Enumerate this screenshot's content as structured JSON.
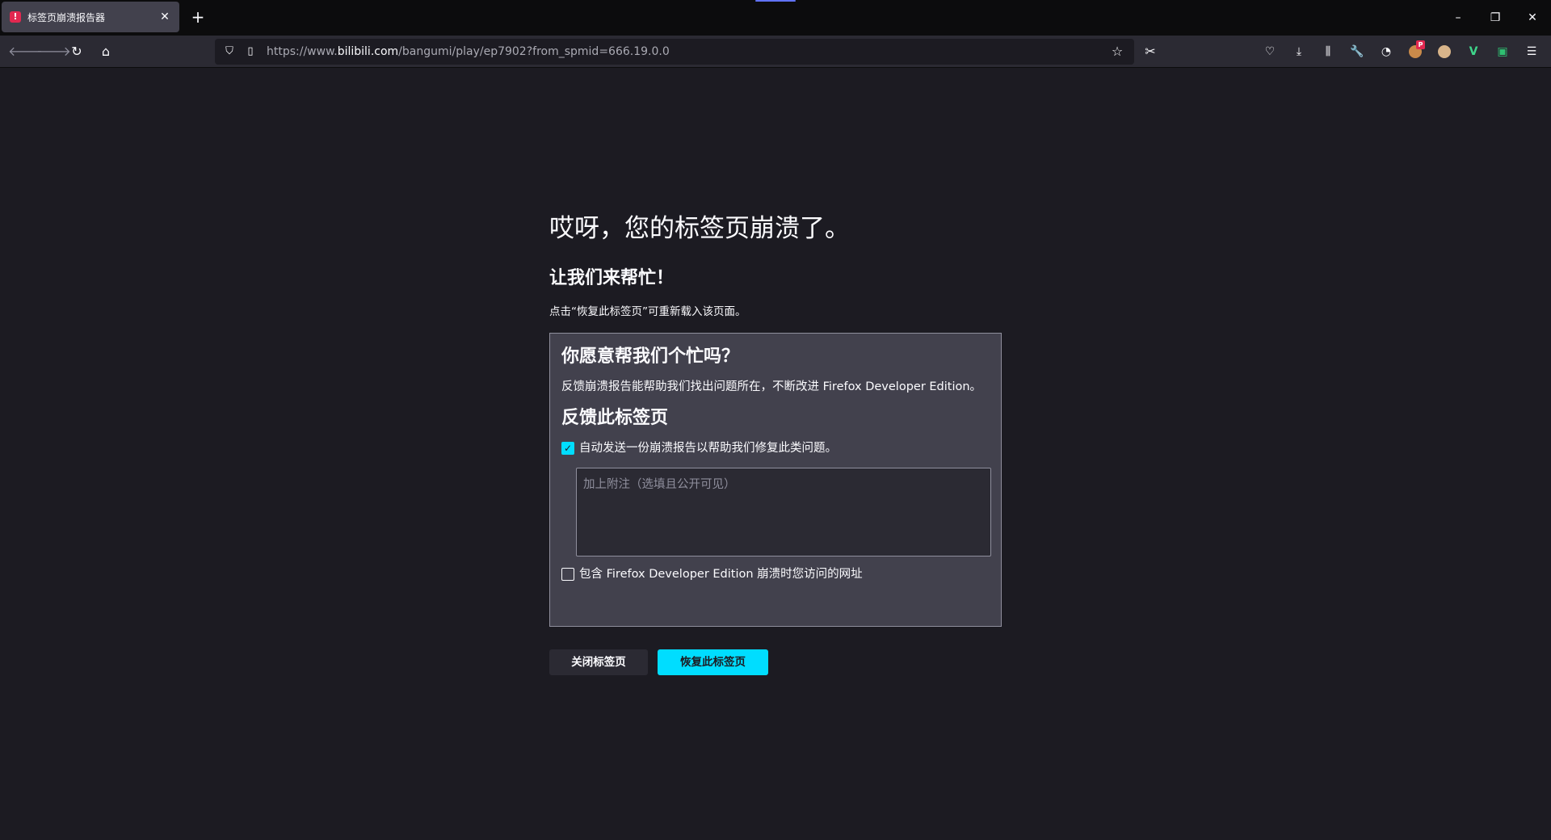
{
  "tab": {
    "title": "标签页崩溃报告器",
    "favicon": "warning-icon"
  },
  "window_controls": {
    "minimize": "–",
    "restore": "❐",
    "close": "✕"
  },
  "navbar": {
    "url_prefix": "https://www.",
    "url_host": "bilibili.com",
    "url_path": "/bangumi/play/ep7902?from_spmid=666.19.0.0"
  },
  "page": {
    "title": "哎呀，您的标签页崩溃了。",
    "subtitle": "让我们来帮忙！",
    "hint": "点击“恢复此标签页”可重新载入该页面。",
    "report": {
      "heading": "你愿意帮我们个忙吗？",
      "description": "反馈崩溃报告能帮助我们找出问题所在，不断改进 Firefox Developer Edition。",
      "heading2": "反馈此标签页",
      "auto_send_label": "自动发送一份崩溃报告以帮助我们修复此类问题。",
      "auto_send_checked": true,
      "comment_placeholder": "加上附注（选填且公开可见）",
      "include_url_label": "包含 Firefox Developer Edition 崩溃时您访问的网址",
      "include_url_checked": false
    },
    "buttons": {
      "close_tab": "关闭标签页",
      "restore_tab": "恢复此标签页"
    }
  },
  "colors": {
    "background": "#1c1b22",
    "accent": "#00ddff",
    "box": "#42414d"
  }
}
